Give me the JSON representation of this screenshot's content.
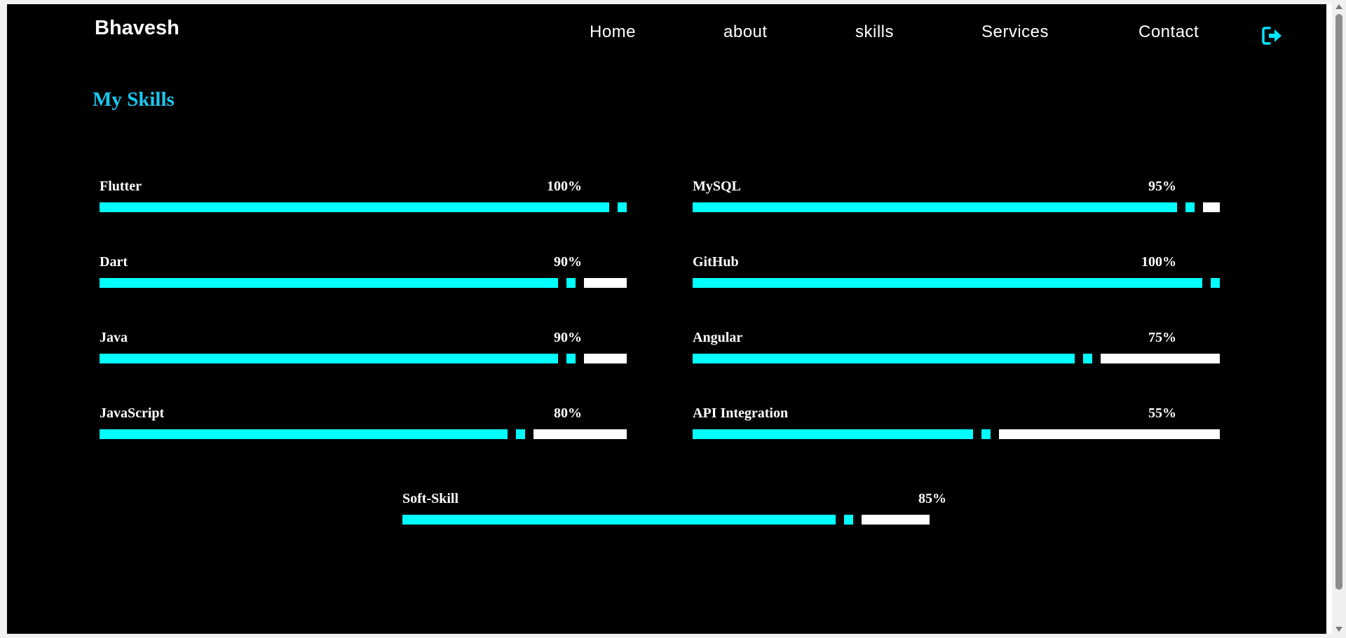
{
  "header": {
    "logo": "Bhavesh",
    "nav": [
      "Home",
      "about",
      "skills",
      "Services",
      "Contact"
    ],
    "logout_icon": "logout-icon"
  },
  "main": {
    "title": "My Skills",
    "skills": [
      {
        "name": "Flutter",
        "percent_label": "100%",
        "value": 100
      },
      {
        "name": "MySQL",
        "percent_label": "95%",
        "value": 95
      },
      {
        "name": "Dart",
        "percent_label": "90%",
        "value": 90
      },
      {
        "name": "GitHub",
        "percent_label": "100%",
        "value": 100
      },
      {
        "name": "Java",
        "percent_label": "90%",
        "value": 90
      },
      {
        "name": "Angular",
        "percent_label": "75%",
        "value": 75
      },
      {
        "name": "JavaScript",
        "percent_label": "80%",
        "value": 80
      },
      {
        "name": "API Integration",
        "percent_label": "55%",
        "value": 55
      },
      {
        "name": "Soft-Skill",
        "percent_label": "85%",
        "value": 85
      }
    ]
  },
  "colors": {
    "background": "#000000",
    "accent": "#00ffff",
    "title": "#17c9f0",
    "bar_rest": "#ffffff",
    "text": "#ffffff"
  }
}
